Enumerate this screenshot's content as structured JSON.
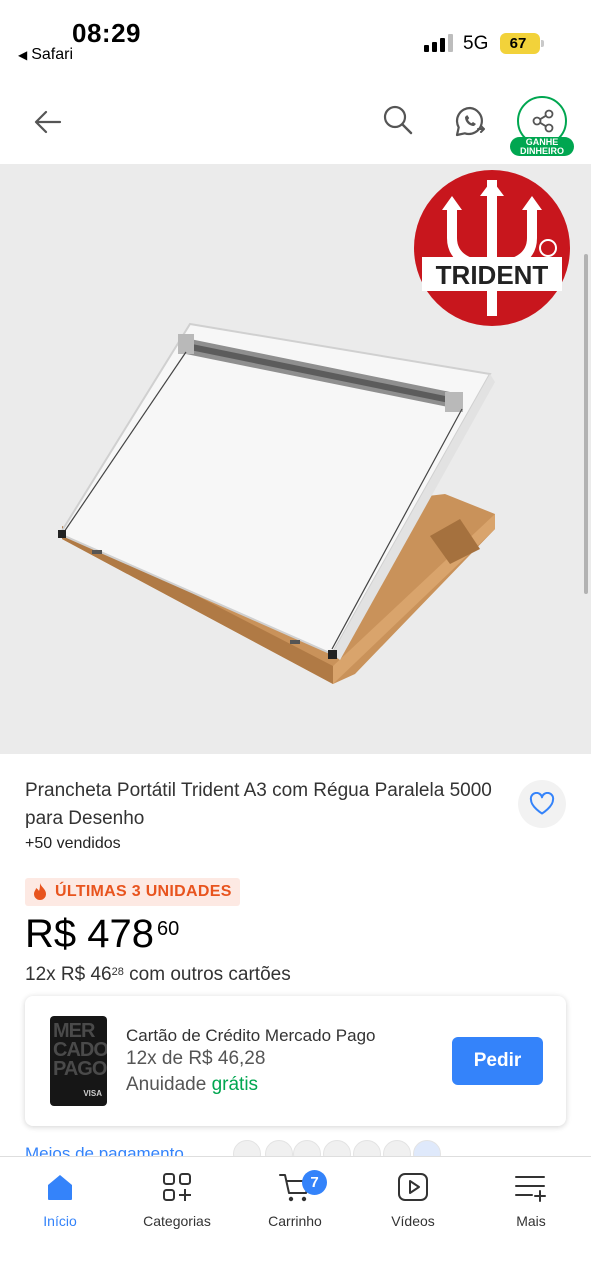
{
  "status_bar": {
    "time": "08:29",
    "back_app": "Safari",
    "network": "5G",
    "battery": "67"
  },
  "header": {
    "earn_label": "GANHE DINHEIRO"
  },
  "product": {
    "title": "Prancheta Portátil Trident A3 com Régua Paralela 5000 para Desenho",
    "sold": "+50 vendidos",
    "stock_badge": "ÚLTIMAS 3 UNIDADES",
    "price_main": "R$ 478",
    "price_cents": "60",
    "installments_prefix": "12x R$ 46",
    "installments_cents": "28",
    "installments_suffix": " com outros cartões",
    "brand_logo_text": "TRIDENT"
  },
  "credit_card": {
    "card_art_text": "MER CADO PAGO",
    "card_brand": "VISA",
    "title": "Cartão de Crédito Mercado Pago",
    "installments": "12x de R$ 46,28",
    "fee_label": "Anuidade",
    "fee_value": "grátis",
    "button": "Pedir"
  },
  "payment": {
    "link": "Meios de pagamento"
  },
  "bottom_nav": {
    "items": [
      {
        "label": "Início",
        "icon": "home-icon"
      },
      {
        "label": "Categorias",
        "icon": "categories-icon"
      },
      {
        "label": "Carrinho",
        "icon": "cart-icon"
      },
      {
        "label": "Vídeos",
        "icon": "play-icon"
      },
      {
        "label": "Mais",
        "icon": "menu-plus-icon"
      }
    ],
    "cart_count": "7"
  },
  "colors": {
    "accent": "#3483fa",
    "green": "#00a650",
    "badge_orange": "#e8541e",
    "trident_red": "#c8161d"
  }
}
